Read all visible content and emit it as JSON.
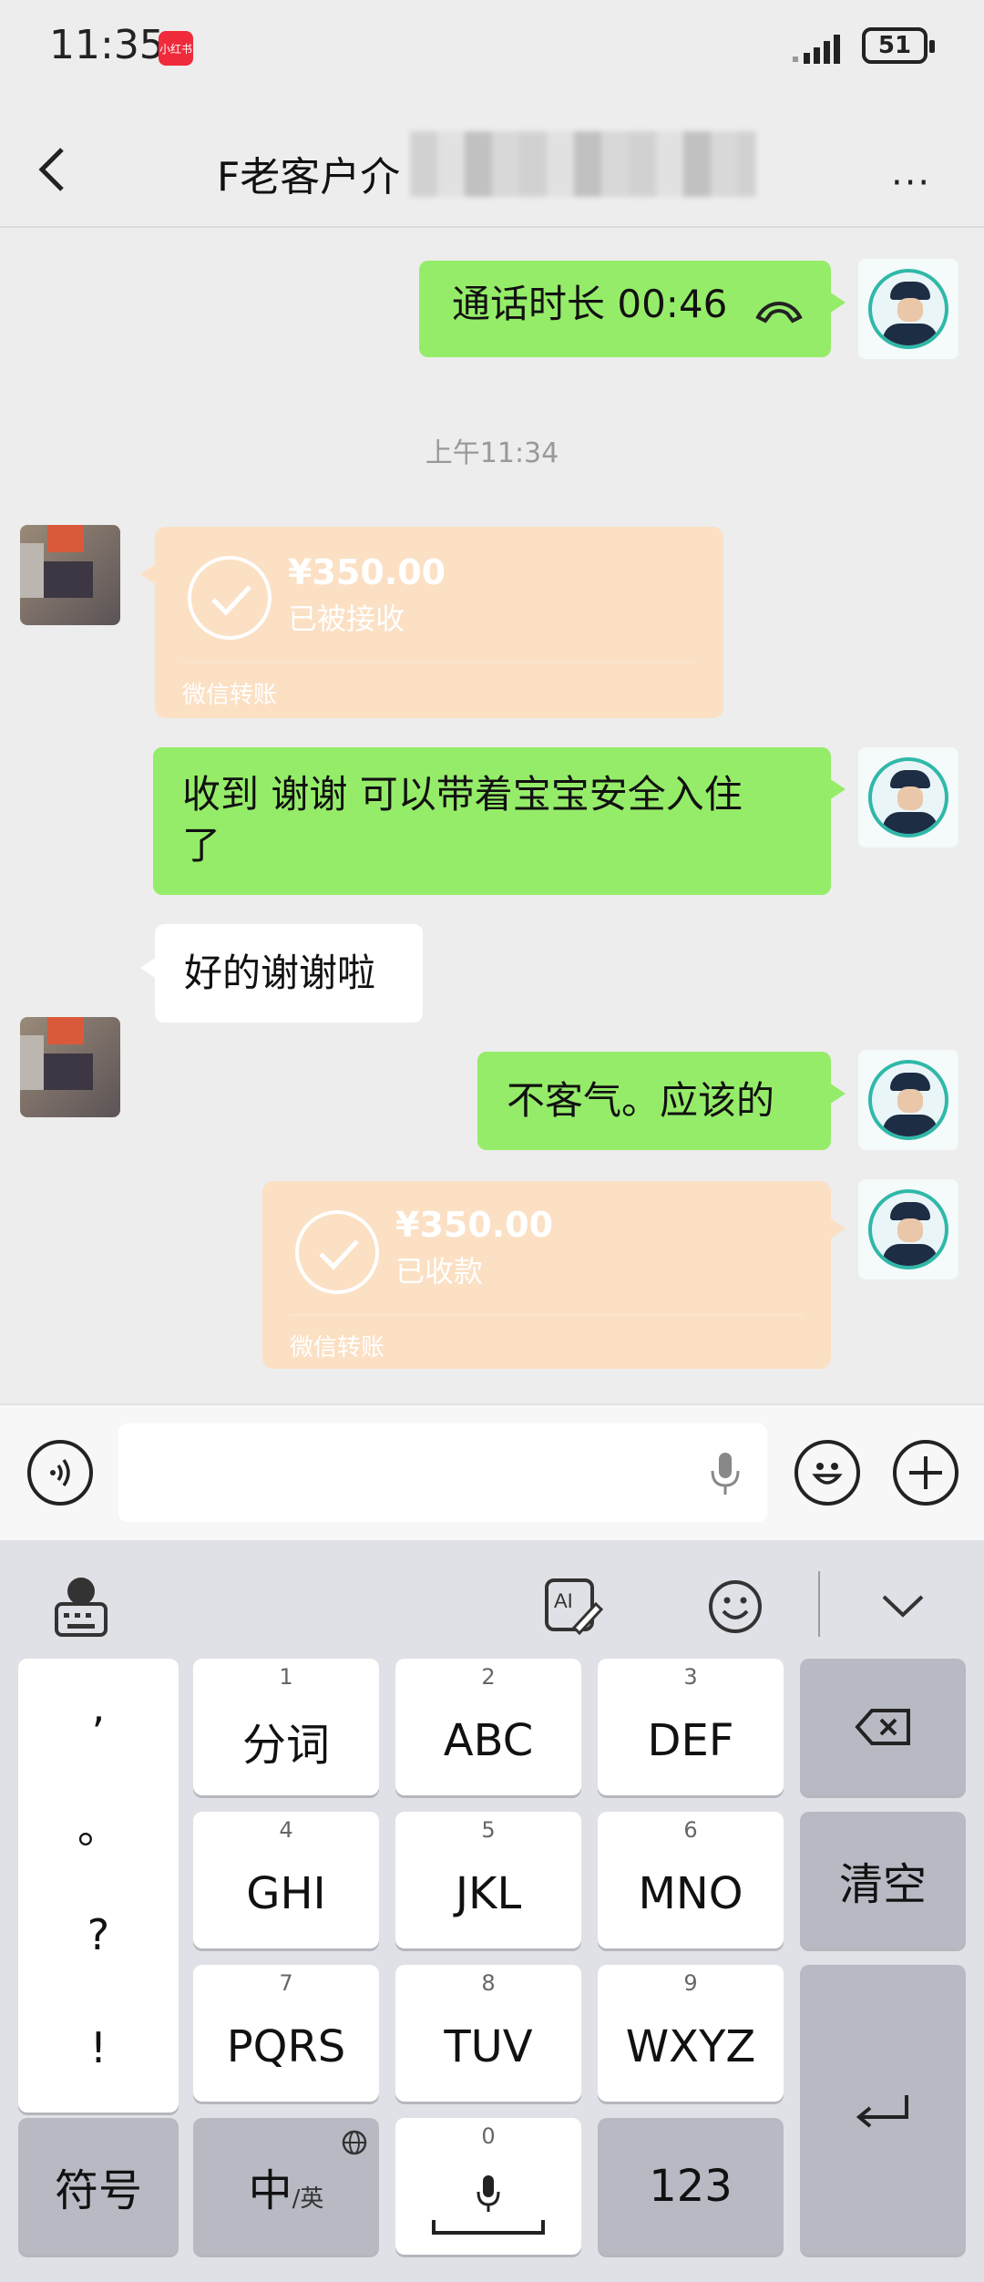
{
  "status_bar": {
    "time": "11:35",
    "app_badge": "小红书",
    "battery": "51"
  },
  "header": {
    "title": "F老客户介",
    "more": "···"
  },
  "messages": {
    "call": {
      "text": "通话时长 00:46"
    },
    "timestamp": "上午11:34",
    "transfer_in": {
      "amount": "¥350.00",
      "status": "已被接收",
      "label": "微信转账"
    },
    "msg1": {
      "line1": "收到 谢谢 可以带着宝宝安全入住",
      "line2": "了"
    },
    "msg2": {
      "text": "好的谢谢啦"
    },
    "msg3": {
      "text": "不客气。应该的"
    },
    "transfer_out": {
      "amount": "¥350.00",
      "status": "已收款",
      "label": "微信转账"
    }
  },
  "keyboard": {
    "punctuation": [
      ",",
      "。",
      "?",
      "!"
    ],
    "row1": [
      {
        "num": "1",
        "label": "分词"
      },
      {
        "num": "2",
        "label": "ABC"
      },
      {
        "num": "3",
        "label": "DEF"
      }
    ],
    "row2": [
      {
        "num": "4",
        "label": "GHI"
      },
      {
        "num": "5",
        "label": "JKL"
      },
      {
        "num": "6",
        "label": "MNO"
      }
    ],
    "row3": [
      {
        "num": "7",
        "label": "PQRS"
      },
      {
        "num": "8",
        "label": "TUV"
      },
      {
        "num": "9",
        "label": "WXYZ"
      }
    ],
    "clear_label": "清空",
    "symbols_label": "符号",
    "lang_main": "中",
    "lang_sub": "/英",
    "space_num": "0",
    "numbers_label": "123"
  },
  "colors": {
    "green_bubble": "#95ec69",
    "transfer": "#fbe0c4",
    "background": "#ededed"
  }
}
